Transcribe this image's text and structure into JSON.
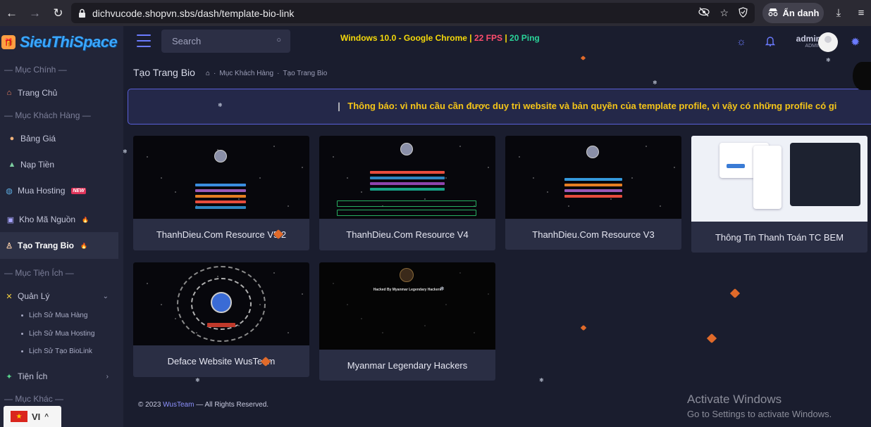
{
  "browser": {
    "url": "dichvucode.shopvn.sbs/dash/template-bio-link",
    "incognito_label": "Ẩn danh"
  },
  "sidebar": {
    "logo": "SieuThiSpace",
    "sections": {
      "main": "— Mục Chính —",
      "customer": "— Mục Khách Hàng —",
      "utility": "— Mục Tiện Ích —",
      "other": "— Mục Khác —"
    },
    "items": [
      {
        "label": "Trang Chủ"
      },
      {
        "label": "Bảng Giá"
      },
      {
        "label": "Nạp Tiền"
      },
      {
        "label": "Mua Hosting",
        "badge": "NEW"
      },
      {
        "label": "Kho Mã Nguồn",
        "badge": "HOT"
      },
      {
        "label": "Tạo Trang Bio",
        "badge": "HOT"
      },
      {
        "label": "Quản Lý"
      },
      {
        "label": "Tiện Ích"
      }
    ],
    "subitems": [
      "Lịch Sử Mua Hàng",
      "Lịch Sử Mua Hosting",
      "Lịch Sử Tạo BioLink"
    ],
    "language": "VI"
  },
  "topbar": {
    "search_placeholder": "Search",
    "sys_os": "Windows 10.0 - Google Chrome",
    "sys_sep": "|",
    "sys_fps": "22 FPS",
    "sys_ping": "20 Ping",
    "user_name": "admin",
    "user_role": "ADMIN"
  },
  "page": {
    "title": "Tạo Trang Bio",
    "breadcrumb": [
      "Mục Khách Hàng",
      "Tạo Trang Bio"
    ],
    "notice": "Thông báo: vì nhu cầu cần được duy trì website và bản quyền của template profile, vì vậy có những profile có gi"
  },
  "templates": [
    {
      "name": "ThanhDieu.Com Resource V5.2"
    },
    {
      "name": "ThanhDieu.Com Resource V4"
    },
    {
      "name": "ThanhDieu.Com Resource V3"
    },
    {
      "name": "Thông Tin Thanh Toán TC BEM"
    },
    {
      "name": "Deface Website WusTeam"
    },
    {
      "name": "Myanmar Legendary Hackers"
    }
  ],
  "thumbs": {
    "hacked_caption": "Hacked By Myanmar Legendary Hackers"
  },
  "footer": {
    "prefix": "© 2023 ",
    "brand": "WusTeam",
    "suffix": " — All Rights Reserved."
  },
  "watermark": {
    "line1": "Activate Windows",
    "line2": "Go to Settings to activate Windows."
  },
  "colors": {
    "accent": "#6b7bff",
    "notice_text": "#f5c518",
    "fps": "#ff4d6d",
    "ping": "#2ad49a"
  }
}
